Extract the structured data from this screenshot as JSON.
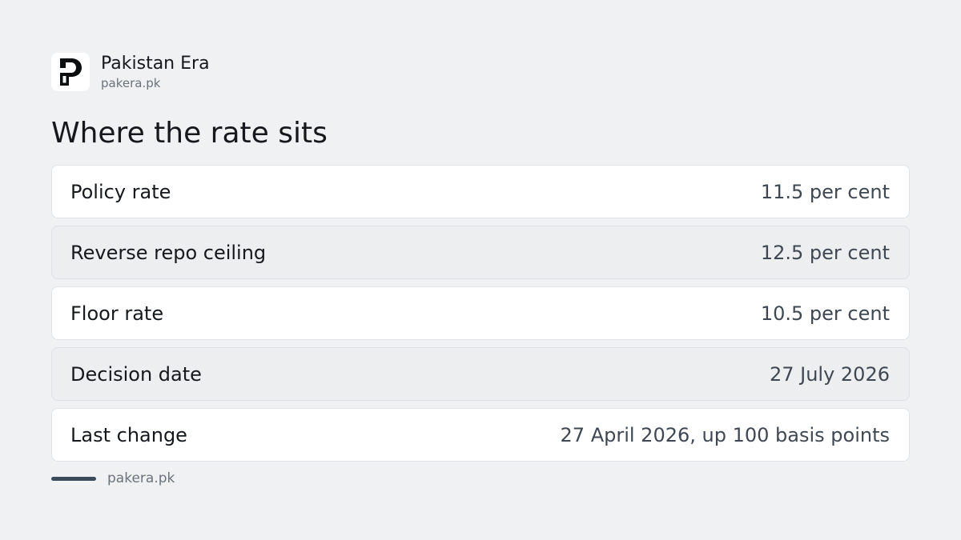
{
  "brand": {
    "name": "Pakistan Era",
    "url": "pakera.pk",
    "logo_icon": "pakistan-era-logo-icon"
  },
  "headline": "Where the rate sits",
  "rows": [
    {
      "label": "Policy rate",
      "value": "11.5 per cent"
    },
    {
      "label": "Reverse repo ceiling",
      "value": "12.5 per cent"
    },
    {
      "label": "Floor rate",
      "value": "10.5 per cent"
    },
    {
      "label": "Decision date",
      "value": "27 July 2026"
    },
    {
      "label": "Last change",
      "value": "27 April 2026, up 100 basis points"
    }
  ],
  "footer": {
    "url": "pakera.pk"
  },
  "colors": {
    "background": "#eff1f3",
    "row_light": "#ffffff",
    "row_shaded": "#eceef0",
    "accent": "#3a4c5c"
  }
}
